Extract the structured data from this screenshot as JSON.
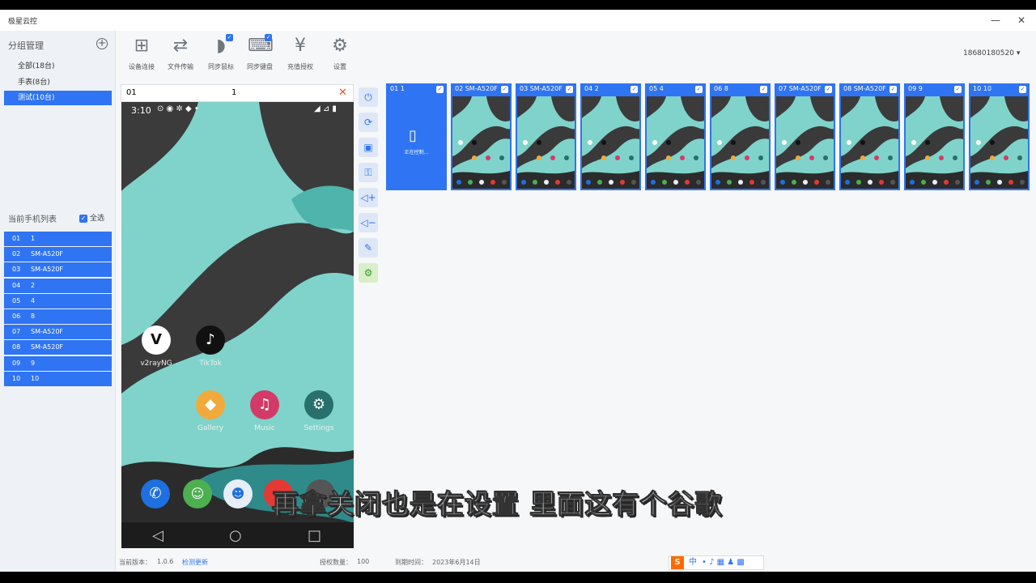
{
  "window": {
    "title": "极星云控",
    "minimize": "—",
    "close": "✕"
  },
  "sidebar": {
    "group_header": "分组管理",
    "add_icon": "+",
    "groups": [
      {
        "label": "全部(18台)",
        "selected": false
      },
      {
        "label": "手表(8台)",
        "selected": false
      },
      {
        "label": "测试(10台)",
        "selected": true
      }
    ],
    "device_list_header": "当前手机列表",
    "select_all_label": "全选",
    "devices": [
      {
        "num": "01",
        "name": "1"
      },
      {
        "num": "02",
        "name": "SM-A520F"
      },
      {
        "num": "03",
        "name": "SM-A520F"
      },
      {
        "num": "04",
        "name": "2"
      },
      {
        "num": "05",
        "name": "4"
      },
      {
        "num": "06",
        "name": "8"
      },
      {
        "num": "07",
        "name": "SM-A520F"
      },
      {
        "num": "08",
        "name": "SM-A520F"
      },
      {
        "num": "09",
        "name": "9"
      },
      {
        "num": "10",
        "name": "10"
      }
    ]
  },
  "toolbar": [
    {
      "label": "设备连接",
      "icon": "device-connect-icon"
    },
    {
      "label": "文件传输",
      "icon": "folder-transfer-icon"
    },
    {
      "label": "同步鼠标",
      "icon": "mouse-sync-icon"
    },
    {
      "label": "同步键盘",
      "icon": "keyboard-sync-icon"
    },
    {
      "label": "充值授权",
      "icon": "yen-icon"
    },
    {
      "label": "设置",
      "icon": "gear-icon"
    }
  ],
  "user": {
    "account": "18680180520 ▾"
  },
  "phone_panel": {
    "num": "01",
    "name": "1",
    "close_icon": "✕",
    "status_time": "3:10",
    "apps": [
      {
        "label": "v2rayNG",
        "color": "#ffffff"
      },
      {
        "label": "TikTok",
        "color": "#111111"
      },
      {
        "label": "Gallery",
        "color": "#f2a93b"
      },
      {
        "label": "Music",
        "color": "#d33a68"
      },
      {
        "label": "Settings",
        "color": "#27706b"
      }
    ]
  },
  "side_controls": [
    "power-icon",
    "rotate-icon",
    "screenshot-icon",
    "key-icon",
    "volume-up-icon",
    "volume-down-icon",
    "edit-icon",
    "settings-multi-icon"
  ],
  "thumbnails": [
    {
      "label": "01      1",
      "connecting": true,
      "connecting_text": "正在控制..."
    },
    {
      "label": "02 SM-A520F",
      "connecting": false
    },
    {
      "label": "03 SM-A520F",
      "connecting": false
    },
    {
      "label": "04      2",
      "connecting": false
    },
    {
      "label": "05      4",
      "connecting": false
    },
    {
      "label": "06      8",
      "connecting": false
    },
    {
      "label": "07 SM-A520F",
      "connecting": false
    },
    {
      "label": "08 SM-A520F",
      "connecting": false
    },
    {
      "label": "09      9",
      "connecting": false
    },
    {
      "label": "10     10",
      "connecting": false
    }
  ],
  "status_bar": {
    "version_label": "当前版本：",
    "version": "1.0.6",
    "check_update": "检测更新",
    "license_label": "授权数量：",
    "license_count": "100",
    "expire_label": "到期时间：",
    "expire_date": "2023年6月14日"
  },
  "subtitle": "再拿关闭也是在设置 里面这有个谷歌",
  "ime": {
    "lang": "中"
  }
}
